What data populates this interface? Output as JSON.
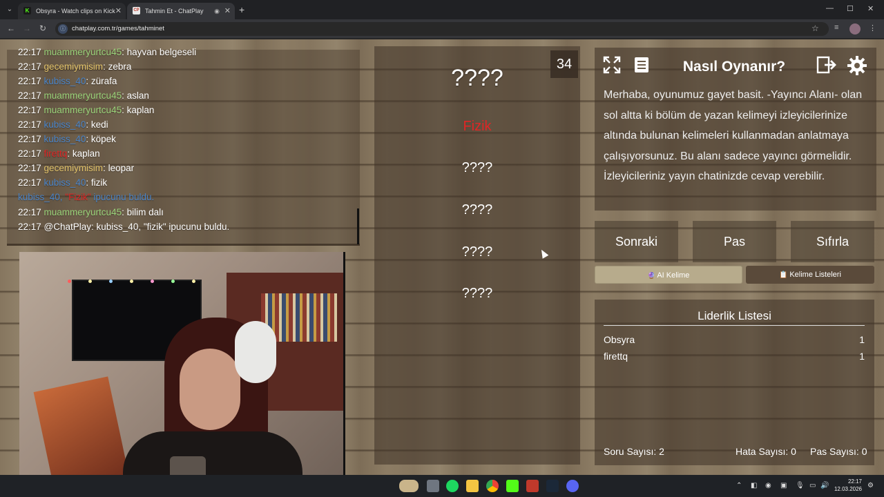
{
  "browser": {
    "tabs": [
      {
        "title": "Obsyra - Watch clips on Kick",
        "favicon": "K",
        "favicon_color": "#53fc18",
        "active": false
      },
      {
        "title": "Tahmin Et - ChatPlay",
        "favicon": "CP",
        "favicon_color": "#c0392b",
        "active": true
      }
    ],
    "url": "chatplay.com.tr/games/tahminet"
  },
  "chat": {
    "lines": [
      {
        "time": "22:17",
        "user": "muammeryurtcu45",
        "user_color": "green",
        "sep": ": ",
        "msg": "hayvan belgeseli"
      },
      {
        "time": "22:17",
        "user": "gecemiymisim",
        "user_color": "yellow",
        "sep": ": ",
        "msg": "zebra"
      },
      {
        "time": "22:17",
        "user": "kubiss_40",
        "user_color": "blue",
        "sep": ": ",
        "msg": "zürafa"
      },
      {
        "time": "22:17",
        "user": "muammeryurtcu45",
        "user_color": "green",
        "sep": ": ",
        "msg": "aslan"
      },
      {
        "time": "22:17",
        "user": "muammeryurtcu45",
        "user_color": "green",
        "sep": ": ",
        "msg": "kaplan"
      },
      {
        "time": "22:17",
        "user": "kubiss_40",
        "user_color": "blue",
        "sep": ": ",
        "msg": "kedi"
      },
      {
        "time": "22:17",
        "user": "kubiss_40",
        "user_color": "blue",
        "sep": ": ",
        "msg": "köpek"
      },
      {
        "time": "22:17",
        "user": "firettq",
        "user_color": "red",
        "sep": ": ",
        "msg": "kaplan"
      },
      {
        "time": "22:17",
        "user": "gecemiymisim",
        "user_color": "yellow",
        "sep": ": ",
        "msg": "leopar"
      },
      {
        "time": "22:17",
        "user": "kubiss_40",
        "user_color": "blue",
        "sep": ": ",
        "msg": "fizik"
      }
    ],
    "notice": {
      "user": "kubiss_40, ",
      "word": "\"Fizik\"",
      "text": " ipucunu buldu."
    },
    "lines2": [
      {
        "time": "22:17",
        "user": "muammeryurtcu45",
        "user_color": "green",
        "sep": ": ",
        "msg": "bilim dalı"
      },
      {
        "time": "22:17",
        "user": "@ChatPlay",
        "user_color": "white",
        "sep": ": ",
        "msg": "kubiss_40, \"fizik\" ipucunu buldu."
      }
    ]
  },
  "game": {
    "timer": "34",
    "main_word": "????",
    "hints": [
      {
        "text": "Fizik",
        "found": true
      },
      {
        "text": "????",
        "found": false
      },
      {
        "text": "????",
        "found": false
      },
      {
        "text": "????",
        "found": false
      },
      {
        "text": "????",
        "found": false
      }
    ]
  },
  "rules": {
    "title": "Nasıl Oynanır?",
    "text": "Merhaba, oyunumuz gayet basit. -Yayıncı Alanı- olan sol altta ki bölüm de yazan kelimeyi izleyicilerinize altında bulunan kelimeleri kullanmadan anlatmaya çalışıyorsunuz. Bu alanı sadece yayıncı görmelidir. İzleyicileriniz yayın chatinizde cevap verebilir."
  },
  "actions": {
    "next": "Sonraki",
    "pass": "Pas",
    "reset": "Sıfırla",
    "ai_word": "AI Kelime",
    "word_lists": "Kelime Listeleri"
  },
  "leaderboard": {
    "title": "Liderlik Listesi",
    "rows": [
      {
        "name": "Obsyra",
        "score": "1"
      },
      {
        "name": "firettq",
        "score": "1"
      }
    ]
  },
  "stats": {
    "questions": "Soru Sayısı: 2",
    "errors": "Hata Sayısı: 0",
    "passes": "Pas Sayısı: 0"
  },
  "taskbar": {
    "time": "22:17",
    "date": "12.03.2026"
  },
  "colors": {
    "user_green": "#9bd37a",
    "user_blue": "#4a84c8",
    "user_red": "#e02525",
    "user_yellow": "#e2c36a",
    "found_hint": "#e02525"
  }
}
